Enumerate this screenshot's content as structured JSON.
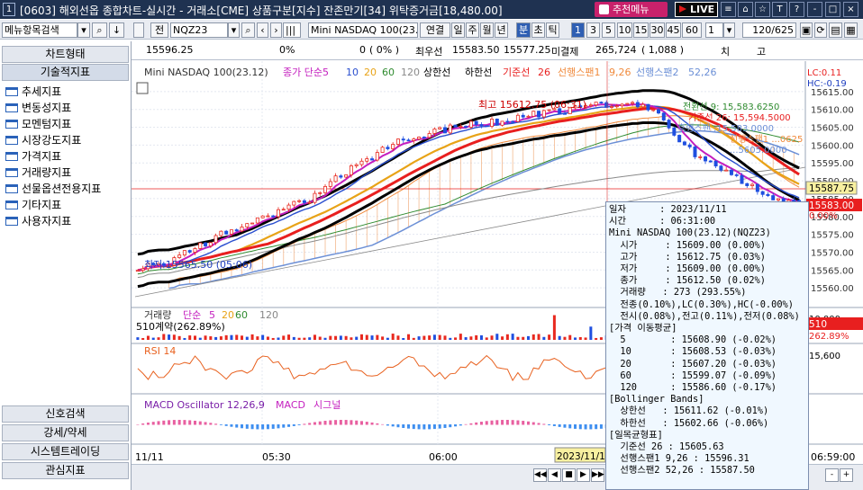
{
  "window": {
    "number": "1",
    "title": "[0603] 해외선옵 종합차트-실시간 - 거래소[CME] 상품구분[지수] 잔존만기[34] 위탁증거금[18,480.00]",
    "recommend_label": "추천메뉴",
    "live_label": "LIVE",
    "icons": {
      "grid": "≡",
      "home": "⌂",
      "star": "☆",
      "help": "?",
      "minimize": "-",
      "maximize": "□",
      "close": "×"
    }
  },
  "toolbar": {
    "menu_search": "메뉴항목검색",
    "all_label": "전",
    "symbol": "NQZ23",
    "symbol_name": "Mini NASDAQ 100(23.1",
    "continuous": "연결",
    "periods": [
      "일",
      "주",
      "월",
      "년",
      "분",
      "초",
      "틱"
    ],
    "minute_values": [
      "1",
      "3",
      "5",
      "10",
      "15",
      "30",
      "45",
      "60"
    ],
    "multiplier": "1",
    "count": "120/625",
    "mode_label": "치",
    "extra_label": "고"
  },
  "info": {
    "price": "15596.25",
    "pct": "0%",
    "change": "0",
    "change_pct": "( 0% )",
    "best_ask_label": "최우선",
    "best_ask": "15583.50",
    "best_bid": "15577.25",
    "open_interest_label": "미결제",
    "open_interest": "265,724",
    "oi_change": "( 1,088 )"
  },
  "sidebar": {
    "top": [
      "차트형태",
      "기술적지표"
    ],
    "items": [
      "추세지표",
      "변동성지표",
      "모멘텀지표",
      "시장강도지표",
      "가격지표",
      "거래량지표",
      "선물옵션전용지표",
      "기타지표",
      "사용자지표"
    ],
    "bottom": [
      "신호검색",
      "강세/약세",
      "시스템트레이딩",
      "관심지표"
    ]
  },
  "chart_data": [
    {
      "type": "candlestick",
      "title": "Mini NASDAQ 100(23.12)",
      "legend": [
        "종가 단순",
        "5",
        "10",
        "20",
        "60",
        "120",
        "상한선",
        "하한선",
        "기준선",
        "26",
        "선행스팬1",
        "9,26",
        "선행스팬2",
        "52,26"
      ],
      "colors": {
        "ma5": "#c41fbf",
        "ma10": "#2a4fcf",
        "ma20": "#e8a317",
        "ma60": "#2f8b2f",
        "ma120": "#8a8a8a",
        "upper": "#000000",
        "lower": "#000000",
        "base": "#e81f1f",
        "span1": "#f08a3c",
        "span2": "#6b8fd6",
        "up": "#e8291f",
        "down": "#1f4fe0"
      },
      "ylim": [
        15555,
        15620
      ],
      "yticks": [
        15560,
        15565,
        15570,
        15575,
        15580,
        15585,
        15590,
        15595,
        15600,
        15605,
        15610,
        15615
      ],
      "xticks": [
        "05:30",
        "06:00"
      ],
      "first_label": "11/11",
      "annotations": {
        "high": "최고 15612.75 (06:31)",
        "low": "최저 15565.50 (05:06)",
        "lc": "LC:0.11",
        "hc": "HC:-0.19",
        "span1": "전환선 9: 15,583.6250",
        "base": "기준선 26: 15,594.5000",
        "span_lag": "후행스팬 :15,583.0000",
        "span2": "선행스팬1 ...0625",
        "span2b": "...5605.0000",
        "price_box": "15587.75",
        "price_box2": "15583.00",
        "price_pct": "0.00%"
      }
    },
    {
      "type": "bar",
      "title": "거래량",
      "legend": [
        "단순",
        "5",
        "20",
        "60",
        "120"
      ],
      "note": "510계약(262.89%)",
      "right_value": "510",
      "right_pct": "262.89%",
      "axis_value": "10,000"
    },
    {
      "type": "line",
      "title": "RSI 14",
      "right_value": "15,600"
    },
    {
      "type": "bar",
      "title": "MACD Oscillator 12,26,9",
      "legend": [
        "MACD",
        "시그널"
      ]
    }
  ],
  "xaxis": {
    "left": "11/11",
    "t1": "05:30",
    "t2": "06:00",
    "date_box": "2023/11/1",
    "end": "06:59:00"
  },
  "tooltip": {
    "lines": [
      "일자      : 2023/11/11",
      "시간      : 06:31:00",
      "Mini NASDAQ 100(23.12)(NQZ23)",
      "  시가     : 15609.00 (0.00%)",
      "  고가     : 15612.75 (0.03%)",
      "  저가     : 15609.00 (0.00%)",
      "  종가     : 15612.50 (0.02%)",
      "  거래량   : 273 (293.55%)",
      "  전종(0.10%),LC(0.30%),HC(-0.00%)",
      "  전시(0.08%),전고(0.11%),전저(0.08%)",
      "[가격 이동평균]",
      "  5        : 15608.90 (-0.02%)",
      "  10       : 15608.53 (-0.03%)",
      "  20       : 15607.20 (-0.03%)",
      "  60       : 15599.07 (-0.09%)",
      "  120      : 15586.60 (-0.17%)",
      "[Bollinger Bands]",
      "  상한선   : 15611.62 (-0.01%)",
      "  하한선   : 15602.66 (-0.06%)",
      "[일목균형표]",
      "  기준선 26 : 15605.63",
      "  선행스팬1 9,26 : 15596.31",
      "  선행스팬2 52,26 : 15587.50"
    ]
  },
  "navbar": {
    "buttons": [
      "◀◀",
      "◀",
      "■",
      "▶",
      "▶▶"
    ],
    "zoom": [
      "-",
      "+"
    ],
    "spin": [
      "▲",
      "▼"
    ]
  }
}
